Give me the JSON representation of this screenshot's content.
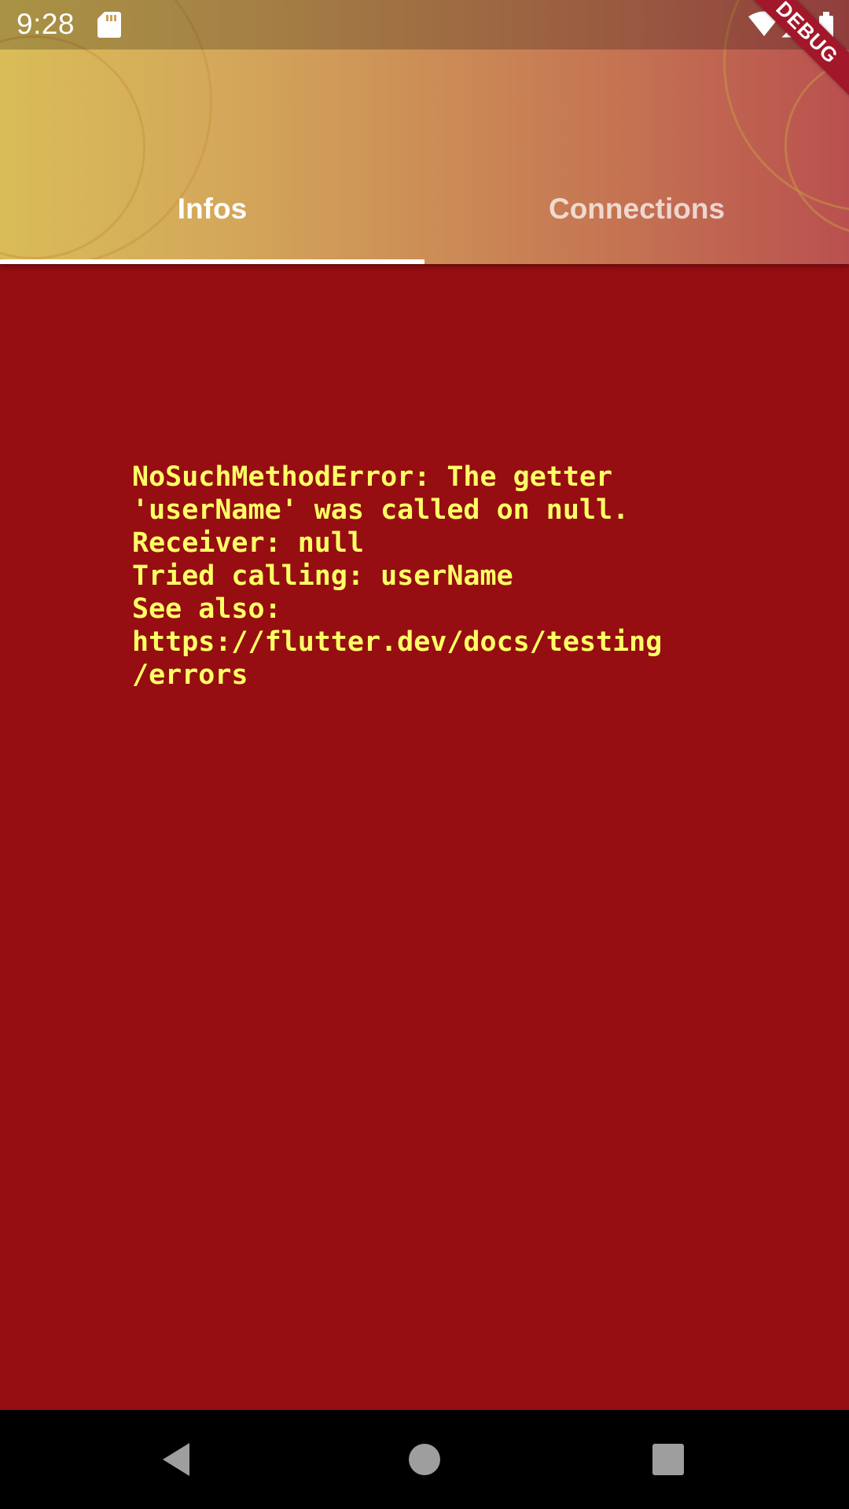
{
  "status_bar": {
    "time": "9:28",
    "icons": [
      "sd-card-icon",
      "wifi-icon",
      "signal-icon",
      "battery-icon"
    ]
  },
  "debug_banner": "DEBUG",
  "tabs": [
    {
      "label": "Infos",
      "selected": true
    },
    {
      "label": "Connections",
      "selected": false
    }
  ],
  "error": {
    "message": "NoSuchMethodError: The getter\n'userName' was called on null.\nReceiver: null\nTried calling: userName\nSee also:\nhttps://flutter.dev/docs/testing\n/errors"
  },
  "nav_bar": {
    "icons": [
      "back-icon",
      "home-icon",
      "recents-icon"
    ]
  },
  "colors": {
    "error_background": "#960e11",
    "error_text": "#ffff66",
    "header_gradient_start": "#d9bc58",
    "header_gradient_end": "#b9504f",
    "debug_banner": "#a3172a"
  }
}
